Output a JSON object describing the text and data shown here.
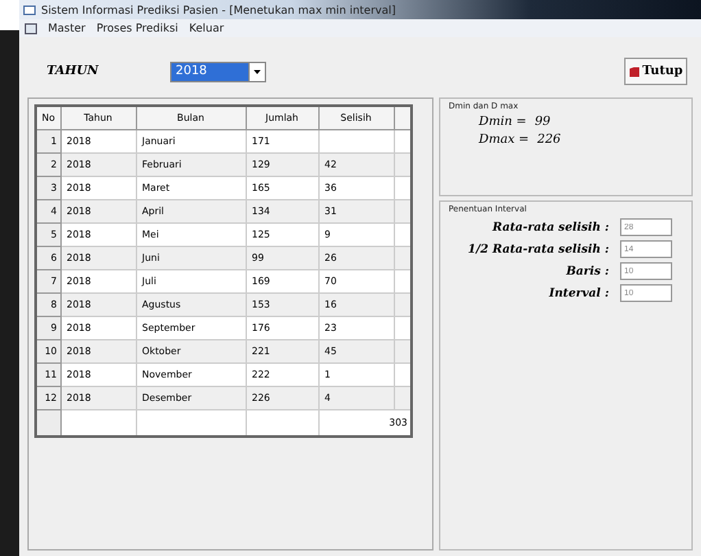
{
  "window": {
    "title": "Sistem Informasi Prediksi Pasien - [Menetukan max min interval]"
  },
  "menu": [
    "Master",
    "Proses Prediksi",
    "Keluar"
  ],
  "year_filter": {
    "label": "TAHUN",
    "value": "2018"
  },
  "close_button": {
    "label": "Tutup"
  },
  "table": {
    "columns": [
      "No",
      "Tahun",
      "Bulan",
      "Jumlah",
      "Selisih"
    ],
    "rows": [
      {
        "no": "1",
        "tahun": "2018",
        "bulan": "Januari",
        "jumlah": "171",
        "selisih": ""
      },
      {
        "no": "2",
        "tahun": "2018",
        "bulan": "Februari",
        "jumlah": "129",
        "selisih": "42"
      },
      {
        "no": "3",
        "tahun": "2018",
        "bulan": "Maret",
        "jumlah": "165",
        "selisih": "36"
      },
      {
        "no": "4",
        "tahun": "2018",
        "bulan": "April",
        "jumlah": "134",
        "selisih": "31"
      },
      {
        "no": "5",
        "tahun": "2018",
        "bulan": "Mei",
        "jumlah": "125",
        "selisih": "9"
      },
      {
        "no": "6",
        "tahun": "2018",
        "bulan": "Juni",
        "jumlah": "99",
        "selisih": "26"
      },
      {
        "no": "7",
        "tahun": "2018",
        "bulan": "Juli",
        "jumlah": "169",
        "selisih": "70"
      },
      {
        "no": "8",
        "tahun": "2018",
        "bulan": "Agustus",
        "jumlah": "153",
        "selisih": "16"
      },
      {
        "no": "9",
        "tahun": "2018",
        "bulan": "September",
        "jumlah": "176",
        "selisih": "23"
      },
      {
        "no": "10",
        "tahun": "2018",
        "bulan": "Oktober",
        "jumlah": "221",
        "selisih": "45"
      },
      {
        "no": "11",
        "tahun": "2018",
        "bulan": "November",
        "jumlah": "222",
        "selisih": "1"
      },
      {
        "no": "12",
        "tahun": "2018",
        "bulan": "Desember",
        "jumlah": "226",
        "selisih": "4"
      }
    ],
    "total": "303"
  },
  "dmin_dmax": {
    "title": "Dmin dan D max",
    "dmin_label": "Dmin =",
    "dmin": "99",
    "dmax_label": "Dmax =",
    "dmax": "226"
  },
  "interval": {
    "title": "Penentuan Interval",
    "fields": [
      {
        "label": "Rata-rata selisih :",
        "value": "28"
      },
      {
        "label": "1/2 Rata-rata selisih :",
        "value": "14"
      },
      {
        "label": "Baris :",
        "value": "10"
      },
      {
        "label": "Interval :",
        "value": "10"
      }
    ]
  }
}
